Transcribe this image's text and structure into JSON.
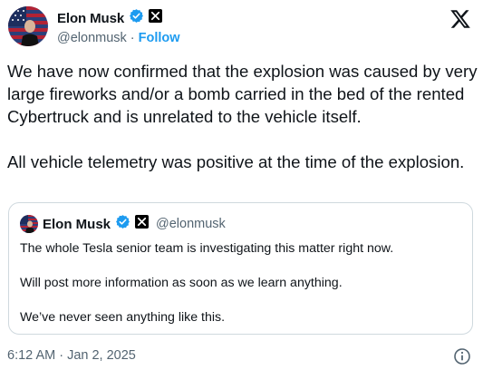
{
  "author": {
    "name": "Elon Musk",
    "handle": "@elonmusk",
    "separator": "·",
    "follow_label": "Follow"
  },
  "tweet": {
    "paragraphs": [
      "We have now confirmed that the explosion was caused by very large fireworks and/or a bomb carried in the bed of the rented Cybertruck and is unrelated to the vehicle itself.",
      "All vehicle telemetry was positive at the time of the explosion."
    ],
    "timestamp": "6:12 AM · Jan 2, 2025"
  },
  "quoted_tweet": {
    "name": "Elon Musk",
    "handle": "@elonmusk",
    "paragraphs": [
      "The whole Tesla senior team is investigating this matter right now.",
      "Will post more information as soon as we learn anything.",
      "We’ve never seen anything like this."
    ]
  },
  "icons": {
    "verified": "verified-badge-icon",
    "affiliate": "x-affiliate-icon",
    "platform_logo": "x-logo-icon",
    "info": "info-icon"
  },
  "colors": {
    "verified_blue": "#1d9bf0",
    "link_blue": "#1d9bf0",
    "text": "#0f1419",
    "secondary_text": "#536471",
    "border": "#cfd9de"
  }
}
